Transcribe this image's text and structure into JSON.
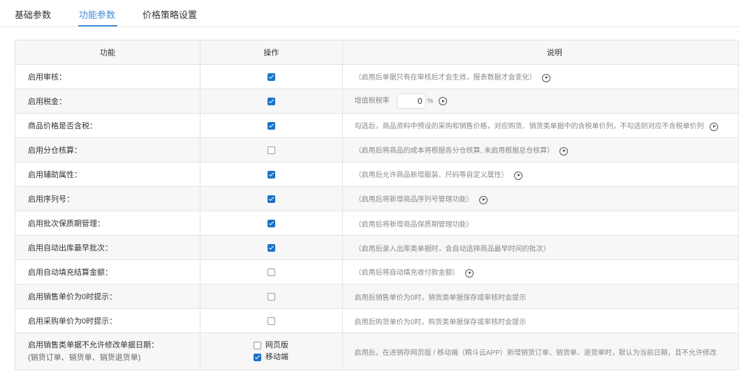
{
  "tabs": [
    {
      "label": "基础参数",
      "active": false
    },
    {
      "label": "功能参数",
      "active": true
    },
    {
      "label": "价格策略设置",
      "active": false
    }
  ],
  "table": {
    "headers": [
      "功能",
      "操作",
      "说明"
    ],
    "rows": [
      {
        "func": "启用审核：",
        "checked": true,
        "desc": "（启用后单据只有在审核后才会生效，报表数据才会变化）",
        "info": true
      },
      {
        "func": "启用税金：",
        "checked": true,
        "desc": "增值税税率",
        "rate_value": "0",
        "rate_unit": "%",
        "info": true
      },
      {
        "func": "商品价格是否含税：",
        "checked": true,
        "desc": "勾选后，商品资料中预设的采购和销售价格，对应购货、销货类单据中的含税单价列，不勾选则对应不含税单价列",
        "info": true
      },
      {
        "func": "启用分仓核算：",
        "checked": false,
        "desc": "（启用后将商品的成本将根据各分仓核算, 未启用根据总仓核算）",
        "info": true
      },
      {
        "func": "启用辅助属性：",
        "checked": true,
        "desc": "（启用后允许商品新增服装、尺码等自定义属性）",
        "info": true
      },
      {
        "func": "启用序列号：",
        "checked": true,
        "desc": "（启用后将新增商品序列号管理功能）",
        "info": true
      },
      {
        "func": "启用批次保质期管理：",
        "checked": true,
        "desc": "（启用后将新增商品保质期管理功能）",
        "info": false
      },
      {
        "func": "启用自动出库最早批次：",
        "checked": true,
        "desc": "（启用后录入出库类单据时，会自动选择商品最早时间的批次）",
        "info": false
      },
      {
        "func": "启用自动填充结算金额：",
        "checked": false,
        "desc": "（启用后将自动填充收付款金额）",
        "info": true
      },
      {
        "func": "启用销售单价为0时提示：",
        "checked": false,
        "desc": "启用后销售单价为0时，销货类单据保存或审核时会提示",
        "info": false
      },
      {
        "func": "启用采购单价为0时提示：",
        "checked": false,
        "desc": "启用后购货单价为0时，购货类单据保存或审核时会提示",
        "info": false
      }
    ],
    "last_row": {
      "func": "启用销售类单据不允许修改单据日期：",
      "func_sub": "(销货订单、销货单、销货退货单)",
      "options": [
        {
          "label": "网页版",
          "checked": false
        },
        {
          "label": "移动端",
          "checked": true
        }
      ],
      "desc": "启用后，在进销存网页版 / 移动端（精斗云APP）新增销货订单、销货单、退货单时，默认为当前日期，且不允许修改"
    }
  },
  "colors": {
    "accent": "#3f8fd6",
    "checkbox": "#1a73c9",
    "row_alt": "#f7f7f7",
    "border": "#e3e3e3"
  },
  "icons": {
    "info": "play-circle-icon",
    "checkbox": "checkbox-icon"
  }
}
